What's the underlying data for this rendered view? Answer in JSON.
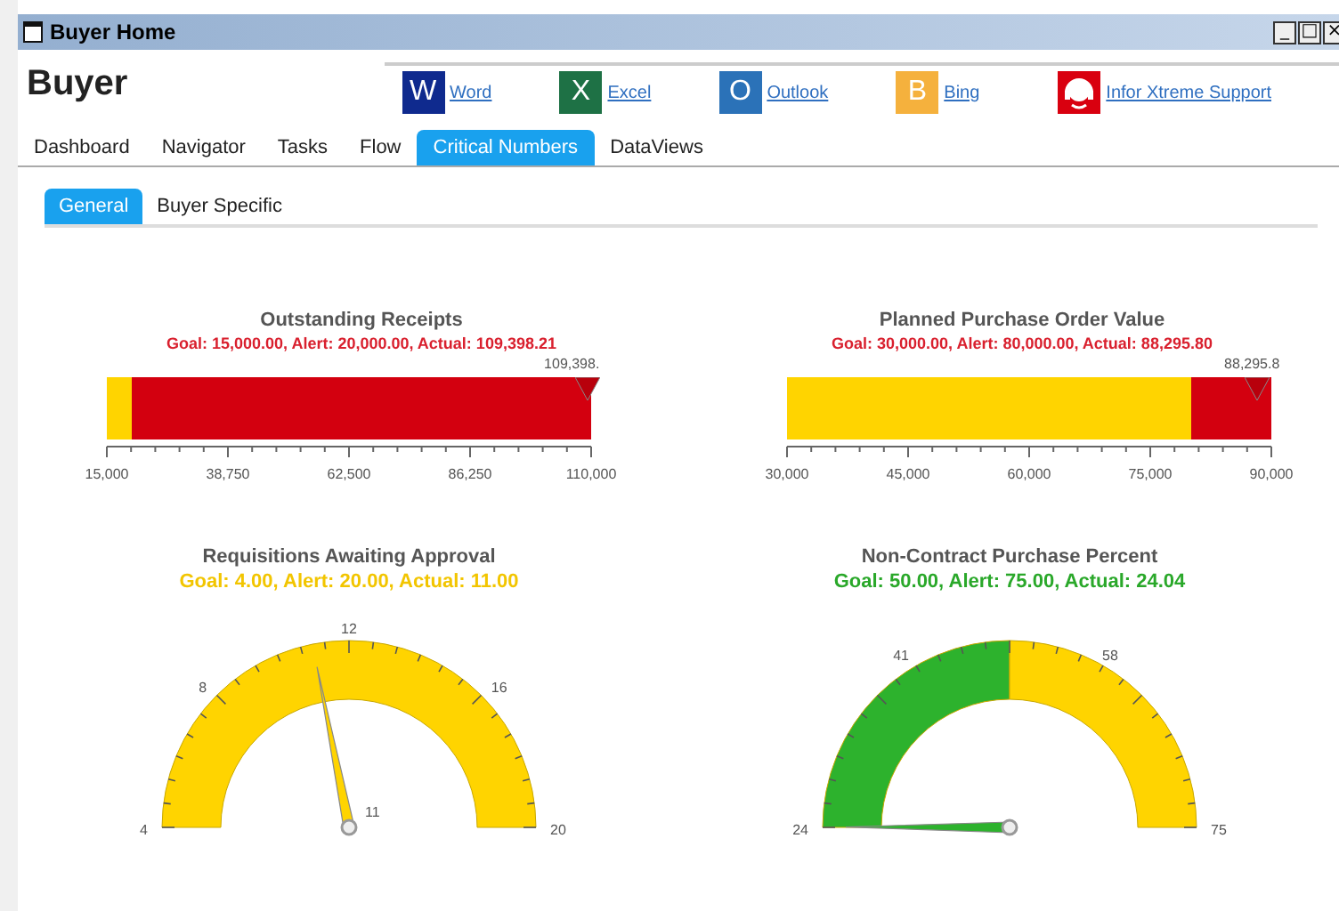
{
  "window": {
    "title": "Buyer Home",
    "controls": [
      "_",
      "□",
      "×"
    ]
  },
  "header": {
    "title": "Buyer"
  },
  "links": [
    {
      "kind": "letter",
      "icon": "W",
      "label": "Word",
      "color": "#0f2a8e"
    },
    {
      "kind": "letter",
      "icon": "X",
      "label": "Excel",
      "color": "#1e7145"
    },
    {
      "kind": "letter",
      "icon": "O",
      "label": "Outlook",
      "color": "#2b72b8"
    },
    {
      "kind": "letter",
      "icon": "B",
      "label": "Bing",
      "color": "#f5b13d"
    },
    {
      "kind": "headset",
      "label": "Infor Xtreme Support",
      "color": "#d9000f"
    }
  ],
  "tabs": [
    {
      "label": "Dashboard",
      "selected": false
    },
    {
      "label": "Navigator",
      "selected": false
    },
    {
      "label": "Tasks",
      "selected": false
    },
    {
      "label": "Flow",
      "selected": false
    },
    {
      "label": "Critical Numbers",
      "selected": true
    },
    {
      "label": "DataViews",
      "selected": false
    }
  ],
  "subtabs": [
    {
      "label": "General",
      "selected": true
    },
    {
      "label": "Buyer Specific",
      "selected": false
    }
  ],
  "panels": [
    {
      "kind": "bullet",
      "title": "Outstanding Receipts",
      "subtitle": "Goal: 15,000.00, Alert: 20,000.00, Actual: 109,398.21",
      "color": "#d9202e",
      "scale": [
        "15,000",
        "38,750",
        "62,500",
        "86,250",
        "110,000"
      ],
      "bands": [
        {
          "color": "#ffd400",
          "level": 0.0526
        },
        {
          "color": "#d3000f"
        }
      ],
      "marker": {
        "level": 0.9937,
        "label": "109,398."
      }
    },
    {
      "kind": "bullet",
      "title": "Planned Purchase Order Value",
      "subtitle": "Goal: 30,000.00, Alert: 80,000.00, Actual: 88,295.80",
      "color": "#d9202e",
      "scale": [
        "30,000",
        "45,000",
        "60,000",
        "75,000",
        "90,000"
      ],
      "bands": [
        {
          "color": "#ffd400",
          "level": 0.8333
        },
        {
          "color": "#d3000f"
        }
      ],
      "marker": {
        "level": 0.9716,
        "label": "88,295.8"
      }
    },
    {
      "kind": "gauge",
      "title": "Requisitions Awaiting Approval",
      "subtitle": "Goal: 4.00, Alert: 20.00, Actual: 11.00",
      "color": "#f2c500",
      "ticks": [
        "4",
        "8",
        "12",
        "16",
        "20"
      ],
      "bands": [
        {
          "color": "#ffd400"
        }
      ],
      "needle": {
        "label": "11"
      }
    },
    {
      "kind": "gauge",
      "title": "Non-Contract Purchase Percent",
      "subtitle": "Goal: 50.00, Alert: 75.00, Actual: 24.04",
      "color": "#2aa82a",
      "ticks": [
        "24",
        "41",
        "58",
        "75"
      ],
      "bands": [
        {
          "color": "#2db22d"
        },
        {
          "color": "#ffd400"
        }
      ]
    }
  ]
}
